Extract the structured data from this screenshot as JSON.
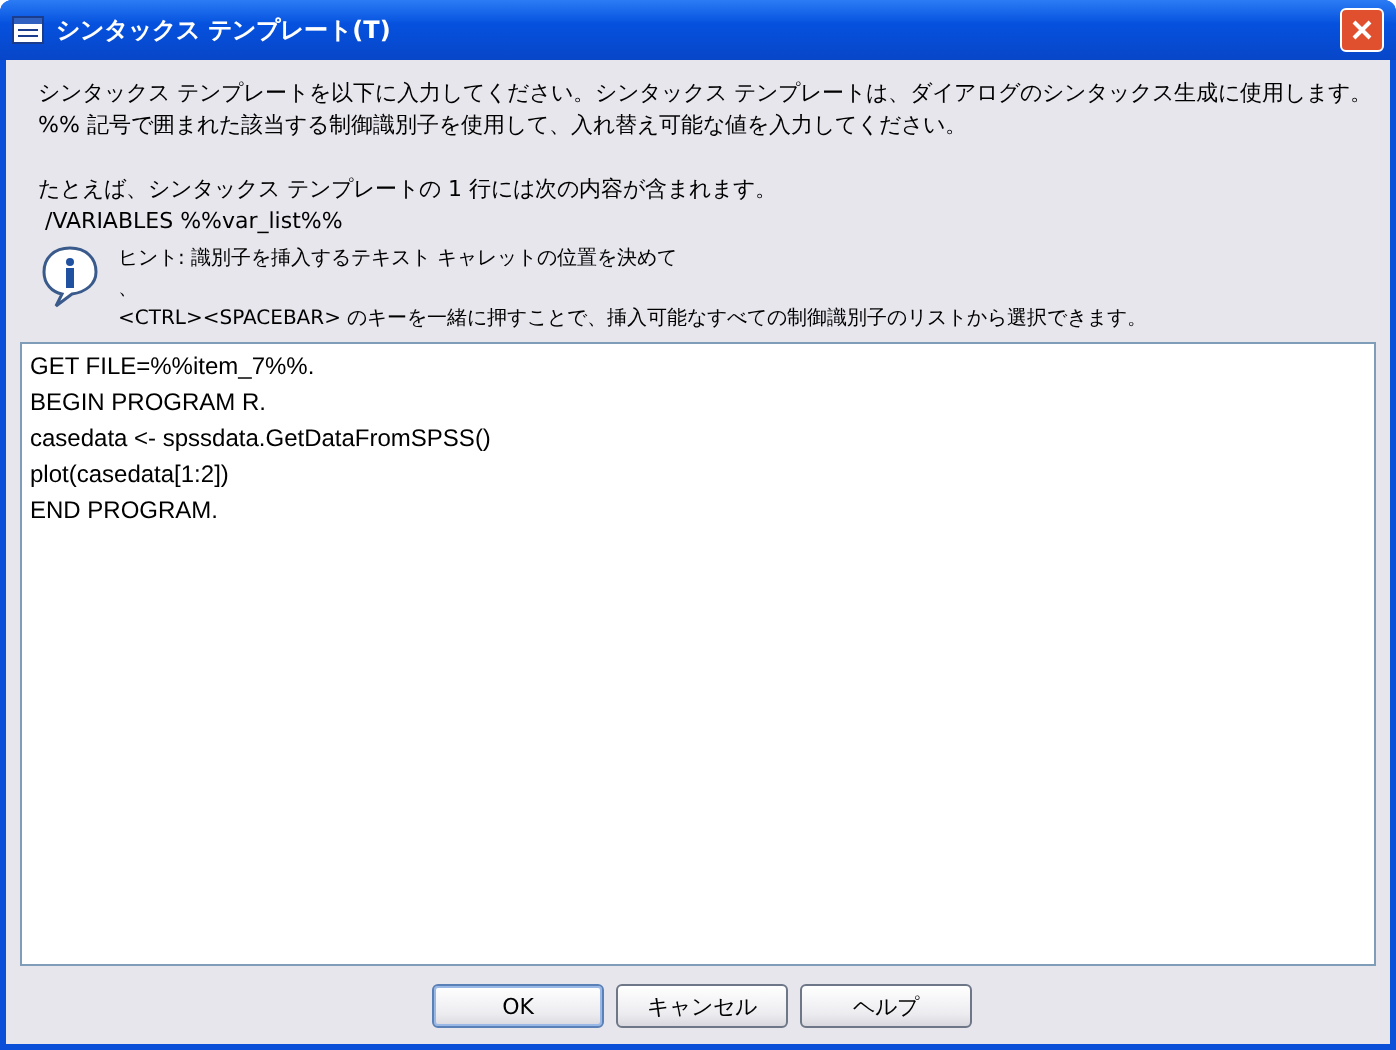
{
  "window": {
    "title": "シンタックス テンプレート(T)"
  },
  "intro": [
    "シンタックス テンプレートを以下に入力してください。シンタックス テンプレートは、ダイアログのシンタックス生成に使用します。",
    "%% 記号で囲まれた該当する制御識別子を使用して、入れ替え可能な値を入力してください。"
  ],
  "example": [
    "たとえば、シンタックス テンプレートの 1 行には次の内容が含まれます。",
    " /VARIABLES %%var_list%%"
  ],
  "hint": [
    "ヒント: 識別子を挿入するテキスト キャレットの位置を決めて",
    "、",
    "<CTRL><SPACEBAR> のキーを一緒に押すことで、挿入可能なすべての制御識別子のリストから選択できます。"
  ],
  "editor": {
    "lines": [
      "GET FILE=%%item_7%%.",
      "BEGIN PROGRAM R.",
      "casedata <- spssdata.GetDataFromSPSS()",
      "plot(casedata[1:2])",
      "END PROGRAM."
    ]
  },
  "buttons": [
    {
      "label": "OK",
      "default": true
    },
    {
      "label": "キャンセル",
      "default": false
    },
    {
      "label": "ヘルプ",
      "default": false
    }
  ]
}
